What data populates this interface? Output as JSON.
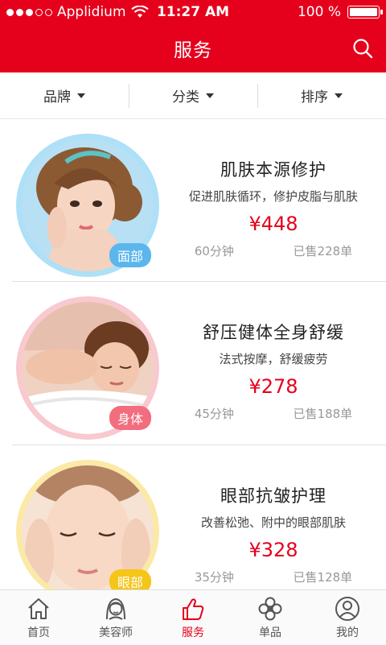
{
  "status_bar": {
    "carrier": "Applidium",
    "time": "11:27 AM",
    "battery": "100 %"
  },
  "nav": {
    "title": "服务"
  },
  "filters": [
    {
      "label": "品牌"
    },
    {
      "label": "分类"
    },
    {
      "label": "排序"
    }
  ],
  "services": [
    {
      "name": "肌肤本源修护",
      "desc": "促进肌肤循环，修护皮脂与肌肤",
      "price": "¥448",
      "duration": "60分钟",
      "sold": "已售228单",
      "tag": "面部",
      "tag_color": "#5bb6ee",
      "ring_color": "#aee0f7"
    },
    {
      "name": "舒压健体全身舒缓",
      "desc": "法式按摩，舒缓疲劳",
      "price": "¥278",
      "duration": "45分钟",
      "sold": "已售188单",
      "tag": "身体",
      "tag_color": "#f26d7d",
      "ring_color": "#f8c9cf"
    },
    {
      "name": "眼部抗皱护理",
      "desc": "改善松弛、附中的眼部肌肤",
      "price": "¥328",
      "duration": "35分钟",
      "sold": "已售128单",
      "tag": "眼部",
      "tag_color": "#f5c518",
      "ring_color": "#fbe9a6"
    }
  ],
  "tabs": [
    {
      "label": "首页",
      "icon": "house-icon"
    },
    {
      "label": "美容师",
      "icon": "beautician-icon"
    },
    {
      "label": "服务",
      "icon": "thumbs-up-icon",
      "active": true
    },
    {
      "label": "单品",
      "icon": "flower-icon"
    },
    {
      "label": "我的",
      "icon": "user-icon"
    }
  ],
  "colors": {
    "brand": "#e5001c"
  }
}
